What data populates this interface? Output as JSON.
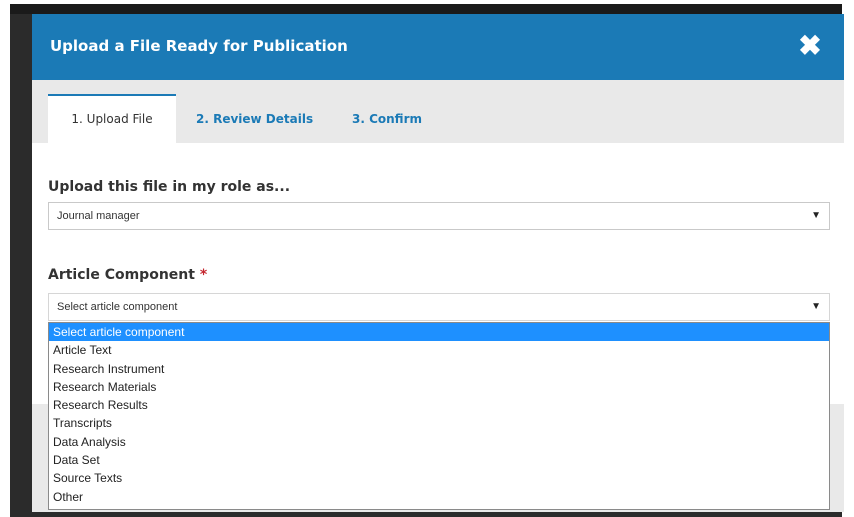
{
  "modal": {
    "title": "Upload a File Ready for Publication",
    "close_symbol": "✖"
  },
  "tabs": [
    {
      "label": "1. Upload File",
      "active": true
    },
    {
      "label": "2. Review Details",
      "active": false
    },
    {
      "label": "3. Confirm",
      "active": false
    }
  ],
  "role": {
    "label": "Upload this file in my role as...",
    "value": "Journal manager"
  },
  "component": {
    "label": "Article Component",
    "required_marker": "*",
    "value": "Select article component",
    "options": [
      "Select article component",
      "Article Text",
      "Research Instrument",
      "Research Materials",
      "Research Results",
      "Transcripts",
      "Data Analysis",
      "Data Set",
      "Source Texts",
      "Other"
    ],
    "selected_index": 0
  },
  "colors": {
    "header": "#1b7ab6",
    "selected_option": "#1e90ff",
    "required": "#c4262e"
  }
}
